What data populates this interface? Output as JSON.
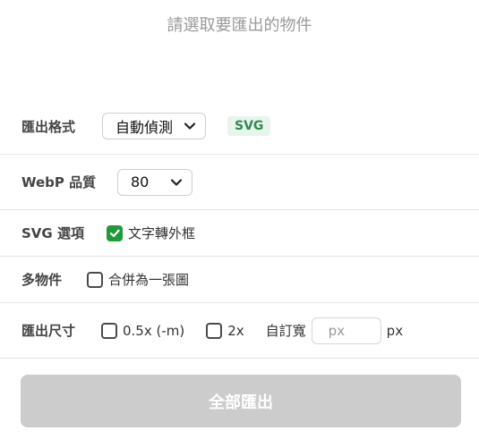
{
  "hint": "請選取要匯出的物件",
  "format": {
    "label": "匯出格式",
    "selected": "自動偵測",
    "badge": "SVG"
  },
  "webp": {
    "label": "WebP 品質",
    "selected": "80"
  },
  "svg_options": {
    "label": "SVG 選項",
    "text_outline": {
      "label": "文字轉外框",
      "checked": true
    }
  },
  "multi": {
    "label": "多物件",
    "merge": {
      "label": "合併為一張圖",
      "checked": false
    }
  },
  "size": {
    "label": "匯出尺寸",
    "half": {
      "label": "0.5x (-m)",
      "checked": false
    },
    "double": {
      "label": "2x",
      "checked": false
    },
    "custom_label": "自訂寬",
    "custom_placeholder": "px",
    "unit": "px"
  },
  "export_button": "全部匯出",
  "colors": {
    "accent_green": "#1f9a3a",
    "badge_bg": "#e8f5ec",
    "badge_text": "#2f8a4e",
    "button_disabled": "#cccccc"
  }
}
